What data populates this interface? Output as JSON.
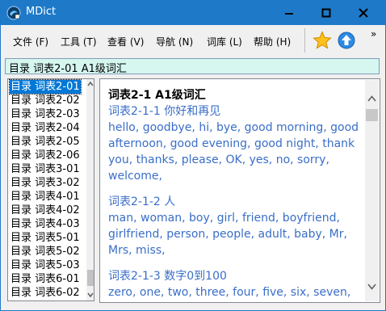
{
  "window": {
    "title": "MDict"
  },
  "menu": [
    {
      "label": "文件 (F)"
    },
    {
      "label": "工具 (T)"
    },
    {
      "label": "查看 (V)"
    },
    {
      "label": "导航 (N)"
    },
    {
      "label": "词库 (L)"
    },
    {
      "label": "帮助 (H)"
    }
  ],
  "toolbar": {
    "overflow": "»"
  },
  "address": {
    "value": "目录 词表2-01 A1级词汇"
  },
  "list": {
    "items": [
      "目录 词表2-01",
      "目录 词表2-02",
      "目录 词表2-03",
      "目录 词表2-04",
      "目录 词表2-05",
      "目录 词表2-06",
      "目录 词表3-01",
      "目录 词表3-02",
      "目录 词表4-01",
      "目录 词表4-02",
      "目录 词表4-03",
      "目录 词表5-01",
      "目录 词表5-02",
      "目录 词表5-03",
      "目录 词表6-01",
      "目录 词表6-02"
    ],
    "selected_index": 0
  },
  "content": {
    "heading": "词表2-1 A1级词汇",
    "sections": [
      {
        "subheading": "词表2-1-1 你好和再见",
        "words": "hello, goodbye, hi, bye, good morning, good afternoon, good evening, good night, thank you, thanks, please, OK, yes, no, sorry, welcome,"
      },
      {
        "subheading": "词表2-1-2 人",
        "words": "man, woman, boy, girl, friend, boyfriend, girlfriend, person, people, adult, baby, Mr, Mrs, miss,"
      },
      {
        "subheading": "词表2-1-3 数字0到100",
        "words": "zero, one, two, three, four, five, six, seven, eight, nine, ten, eleven, twelve, thirteen,"
      }
    ]
  }
}
